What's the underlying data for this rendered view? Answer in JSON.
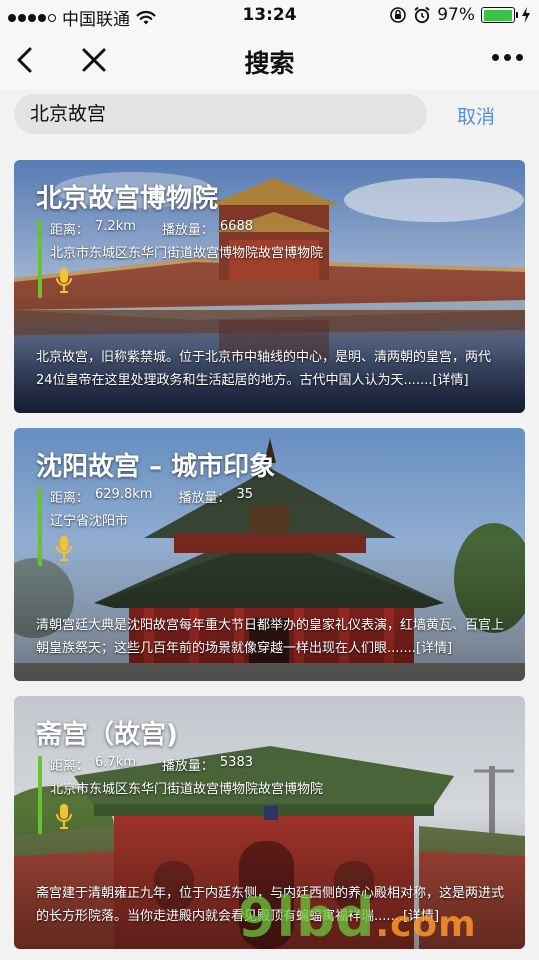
{
  "status_bar": {
    "carrier": "中国联通",
    "time": "13:24",
    "battery": "97%",
    "battery_level": 0.97,
    "signal_dots_filled": 4,
    "icons": [
      "signal-dots-icon",
      "wifi-icon",
      "orientation-lock-icon",
      "alarm-icon",
      "battery-icon",
      "charging-icon"
    ]
  },
  "nav": {
    "title": "搜索",
    "icons": [
      "back-arrow-icon",
      "close-icon",
      "more-dots-icon"
    ]
  },
  "search": {
    "value": "北京故宫",
    "cancel_label": "取消"
  },
  "results": [
    {
      "title": "北京故宫博物院",
      "distance_label": "距离：",
      "distance": "7.2km",
      "plays_label": "播放量：",
      "plays": "6688",
      "address": "北京市东城区东华门街道故宫博物院故宫博物院",
      "description": "北京故宫，旧称紫禁城。位于北京市中轴线的中心，是明、清两朝的皇宫，两代24位皇帝在这里处理政务和生活起居的地方。古代中国人认为天.......",
      "more": "[详情]",
      "icon": "microphone-icon"
    },
    {
      "title": "沈阳故宫 – 城市印象",
      "distance_label": "距离：",
      "distance": "629.8km",
      "plays_label": "播放量：",
      "plays": "35",
      "address": "辽宁省沈阳市",
      "description": "清朝宫廷大典是沈阳故宫每年重大节日都举办的皇家礼仪表演，红墙黄瓦、百官上朝皇族祭天；这些几百年前的场景就像穿越一样出现在人们眼.......",
      "more": "[详情]",
      "icon": "microphone-icon"
    },
    {
      "title": "斋宫（故宫)",
      "distance_label": "距离：",
      "distance": "6.7km",
      "plays_label": "播放量：",
      "plays": "5383",
      "address": "北京市东城区东华门街道故宫博物院故宫博物院",
      "description": "斋宫建于清朝雍正九年，位于内廷东侧，与内廷西侧的养心殿相对称，这是两进式的长方形院落。当你走进殿内就会看见殿顶有蝙蝠寓福祥瑞.......",
      "more": "[详情]",
      "icon": "microphone-icon"
    }
  ],
  "watermark": {
    "main": "9lbd",
    "suffix": ".com"
  },
  "colors": {
    "accent_green": "#6ac233",
    "cancel_blue": "#5b8fd4",
    "search_bg": "#e3e3e6",
    "battery_green": "#3ac24a"
  }
}
